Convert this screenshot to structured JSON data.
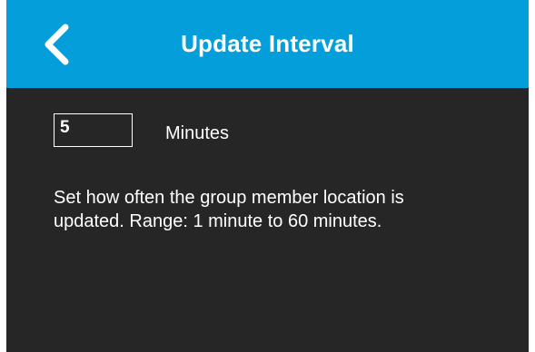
{
  "header": {
    "title": "Update Interval",
    "back_icon": "chevron-left-icon",
    "background_color": "#049fdb"
  },
  "interval": {
    "value": "5",
    "unit_label": "Minutes"
  },
  "description": "Set how often the group member location is updated. Range: 1 minute to 60 minutes.",
  "colors": {
    "screen_background": "#262626",
    "text": "#ffffff"
  }
}
